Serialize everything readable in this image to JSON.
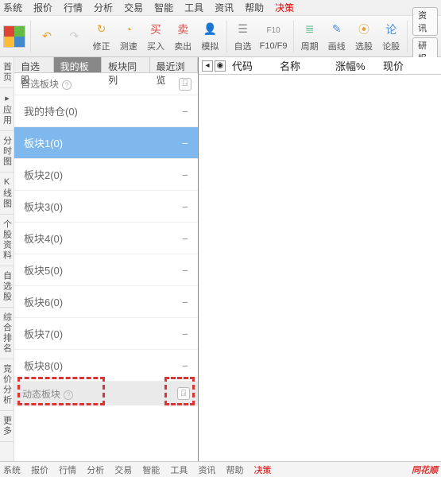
{
  "menubar": [
    "系统",
    "报价",
    "行情",
    "分析",
    "交易",
    "智能",
    "工具",
    "资讯",
    "帮助"
  ],
  "menubar_extra": "决策",
  "toolbar": {
    "back_icon": "↶",
    "forward_icon": "↷",
    "items": [
      {
        "label": "修正",
        "color": "#e6a23c",
        "glyph": "↻"
      },
      {
        "label": "测速",
        "color": "#e6a23c",
        "glyph": "◔"
      },
      {
        "label": "买入",
        "color": "#d9534f",
        "glyph": "买"
      },
      {
        "label": "卖出",
        "color": "#d9534f",
        "glyph": "卖"
      },
      {
        "label": "模拟",
        "color": "#e6a23c",
        "glyph": "👤"
      },
      {
        "label": "自选",
        "color": "#8a8a8a",
        "glyph": "☰"
      },
      {
        "label": "F10/F9",
        "color": "#888",
        "glyph": "F10"
      },
      {
        "label": "周期",
        "color": "#5b8",
        " glyph": "≡"
      },
      {
        "label": "画线",
        "color": "#4a90d9",
        "glyph": "✎"
      },
      {
        "label": "选股",
        "color": "#e6a23c",
        "glyph": "⦿"
      },
      {
        "label": "论股",
        "color": "#4a90d9",
        "glyph": "论"
      }
    ],
    "side": [
      {
        "label": "资讯"
      },
      {
        "label": "研报"
      }
    ]
  },
  "sidebar_left": [
    "首页",
    "▸应用",
    "分时图",
    "K线图",
    "个股资料",
    "自选股",
    "综合排名",
    "竞价分析",
    "更多"
  ],
  "panel": {
    "tabs": [
      "自选股",
      "我的板块",
      "板块同列",
      "最近浏览"
    ],
    "active_tab_index": 1,
    "header": {
      "label": "自选板块",
      "add_glyph": "⍈"
    },
    "items": [
      {
        "label": "我的持仓(0)"
      },
      {
        "label": "板块1(0)",
        "selected": true
      },
      {
        "label": "板块2(0)"
      },
      {
        "label": "板块3(0)"
      },
      {
        "label": "板块4(0)"
      },
      {
        "label": "板块5(0)"
      },
      {
        "label": "板块6(0)"
      },
      {
        "label": "板块7(0)"
      },
      {
        "label": "板块8(0)"
      }
    ],
    "dynamic_section": {
      "label": "动态板块",
      "add_glyph": "⍈"
    }
  },
  "main_columns": [
    "代码",
    "名称",
    "涨幅%",
    "现价"
  ],
  "statusbar": {
    "left": [
      "系统",
      "报价",
      "行情",
      "分析",
      "交易",
      "智能",
      "工具",
      "资讯",
      "帮助"
    ],
    "left_extra": "决策",
    "brand": "同花顺"
  }
}
